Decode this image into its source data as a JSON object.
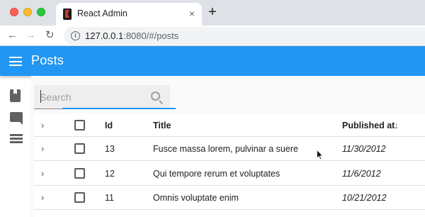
{
  "browser": {
    "tab_title": "React Admin",
    "tab_close": "×",
    "new_tab": "+",
    "url_host": "127.0.0.1",
    "url_rest": ":8080/#/posts",
    "info_glyph": "i",
    "back_glyph": "←",
    "forward_glyph": "→",
    "reload_glyph": "↻"
  },
  "appbar": {
    "title": "Posts",
    "color": "#2196f3"
  },
  "sidebar": {
    "items": [
      {
        "icon": "book-icon"
      },
      {
        "icon": "comment-icon"
      },
      {
        "icon": "list-icon"
      }
    ]
  },
  "search": {
    "placeholder": "Search",
    "value": ""
  },
  "table": {
    "headers": {
      "id": "Id",
      "title": "Title",
      "published_at": "Published at",
      "sort_glyph": "↓"
    },
    "expand_glyph": "›",
    "rows": [
      {
        "id": "13",
        "title": "Fusce massa lorem, pulvinar a suere",
        "published_at": "11/30/2012"
      },
      {
        "id": "12",
        "title": "Qui tempore rerum et voluptates",
        "published_at": "11/6/2012"
      },
      {
        "id": "11",
        "title": "Omnis voluptate enim",
        "published_at": "10/21/2012"
      }
    ]
  }
}
